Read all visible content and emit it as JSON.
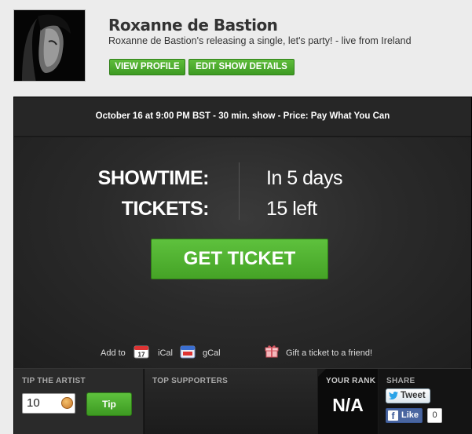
{
  "artist": {
    "name": "Roxanne de Bastion",
    "tagline": "Roxanne de Bastion's releasing a single, let's party! - live from Ireland"
  },
  "header_buttons": {
    "view_profile": "VIEW PROFILE",
    "edit_show": "EDIT SHOW DETAILS"
  },
  "show": {
    "info": "October 16 at 9:00 PM BST - 30 min. show - Price: Pay What You Can",
    "showtime_label": "SHOWTIME:",
    "showtime_value": "In 5 days",
    "tickets_label": "TICKETS:",
    "tickets_value": "15 left",
    "get_ticket": "GET TICKET"
  },
  "calendar": {
    "add_to": "Add to",
    "ical_day": "17",
    "ical": "iCal",
    "gcal": "gCal",
    "gift": "Gift a ticket to a friend!"
  },
  "footer": {
    "tip_title": "TIP THE ARTIST",
    "tip_amount": "10",
    "tip_button": "Tip",
    "supporters_title": "TOP SUPPORTERS",
    "rank_title": "YOUR RANK",
    "rank_value": "N/A",
    "share_title": "SHARE",
    "tweet": "Tweet",
    "like": "Like",
    "like_count": "0"
  },
  "colors": {
    "accent_green": "#4caf2e",
    "panel_dark": "#1c1c1c",
    "page_bg": "#ececec"
  }
}
